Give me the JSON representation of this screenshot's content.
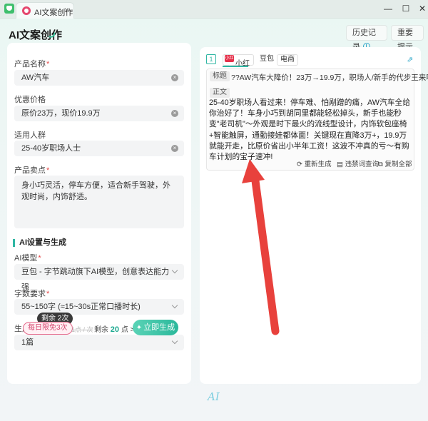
{
  "window": {
    "tab_title": "AI文案创作",
    "close_glyph": "×",
    "minimize_glyph": "—",
    "maximize_glyph": "☐",
    "window_close_glyph": "✕"
  },
  "header": {
    "title": "AI文案创作",
    "history_label": "历史记录",
    "reprompt_label": "重要提示"
  },
  "form": {
    "product_name": {
      "label": "产品名称",
      "required": "*",
      "value": "AW汽车"
    },
    "price": {
      "label": "优惠价格",
      "value": "原价23万，现价19.9万"
    },
    "audience": {
      "label": "适用人群",
      "value": "25-40岁职场人士"
    },
    "selling_points": {
      "label": "产品卖点",
      "required": "*",
      "value": "身小巧灵活，停车方便，适合新手驾驶，外观时尚，内饰舒适。"
    },
    "section_title": "AI设置与生成",
    "model": {
      "label": "AI模型",
      "required": "*",
      "value": "豆包 - 字节跳动旗下AI模型，创意表达能力强"
    },
    "word_count": {
      "label": "字数要求",
      "required": "*",
      "value": "55~150字 (≈15~30s正常口播时长)"
    },
    "count": {
      "label": "生成篇数",
      "required": "*",
      "value": "1篇"
    }
  },
  "generate": {
    "quota_pill": "剩余 2次",
    "daily_free": "每日限免",
    "daily_free_count": "3次",
    "strike_text": "1点 / 次",
    "remain_prefix": "剩余",
    "remain_points": "20",
    "remain_suffix": "点 >",
    "button_label": "立即生成"
  },
  "result": {
    "count": "1",
    "platforms": [
      "小红书",
      "豆包",
      "电商"
    ],
    "xhs_logo": "小红书",
    "title_tag": "标题",
    "title": "??AW汽车大降价！23万→19.9万，职场人/新手的代步王来啦～",
    "body_tag": "正文",
    "body": "25-40岁职场人看过来！停车难、怕剐蹭的痛，AW汽车全给你治好了！车身小巧到胡同里都能轻松掉头，新手也能秒变\"老司机\"～外观是时下最火的流线型设计，内饰软包座椅+智能触屏，通勤接娃都体面！关键现在直降3万+，19.9万就能开走，比原价省出小半年工资！这波不冲真的亏～有购车计划的宝子速冲!",
    "actions": {
      "regenerate": "重新生成",
      "violation_check": "违禁词查询",
      "copy_all": "复制全部"
    }
  },
  "footer": {
    "logo": "AI"
  },
  "colors": {
    "accent": "#2fb6a3",
    "arrow": "#e8413c",
    "xhs_red": "#e5304a"
  }
}
